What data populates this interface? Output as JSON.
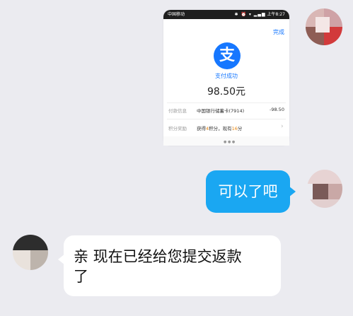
{
  "payment_screenshot": {
    "status_bar": {
      "left": "中国移动",
      "right_icons": "✱ ⏰ ▾ ▂▄▆",
      "time": "上午8:27"
    },
    "done_label": "完成",
    "logo_glyph": "支",
    "logo_icon": "alipay-icon",
    "status": "支付成功",
    "amount": "98.50元",
    "payment_method": {
      "label": "付款信息",
      "value": "中国银行储蓄卡(7914)",
      "amount": "-98.50"
    },
    "points": {
      "label": "积分奖励",
      "prefix": "获得",
      "earned": "4",
      "middle": "积分，现有",
      "current": "16",
      "suffix": "分"
    },
    "nav_dots": "● ● ●"
  },
  "messages": {
    "outgoing": "可以了吧",
    "incoming_line1": "亲  现在已经给您提交返款",
    "incoming_line2": "了"
  },
  "colors": {
    "bubble_outgoing": "#1aa7f2",
    "bubble_incoming": "#ffffff",
    "chat_background": "#ebebf0",
    "alipay_blue": "#1677ff",
    "points_highlight": "#e8850c"
  }
}
